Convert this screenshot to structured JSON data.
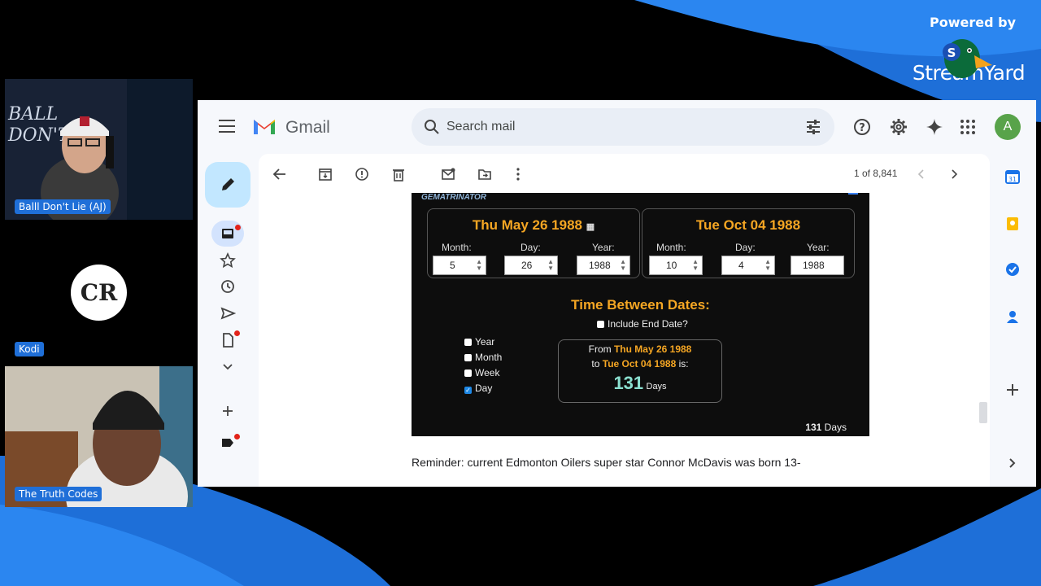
{
  "branding": {
    "powered_by": "Powered by",
    "name": "StreamYard"
  },
  "participants": [
    {
      "name": "Balll Don't Lie (AJ)"
    },
    {
      "name": "Kodi",
      "initials": "CR"
    },
    {
      "name": "The Truth Codes"
    }
  ],
  "gmail": {
    "app_name": "Gmail",
    "search_placeholder": "Search mail",
    "avatar_letter": "A",
    "pager": "1 of 8,841",
    "reminder": "Reminder: current Edmonton Oilers super star Connor McDavis was born 13-"
  },
  "calculator": {
    "brand": "GEMATRINATOR",
    "start_date": {
      "title": "Thu May 26 1988",
      "month": "5",
      "day": "26",
      "year": "1988"
    },
    "end_date": {
      "title": "Tue Oct 04 1988",
      "month": "10",
      "day": "4",
      "year": "1988"
    },
    "labels": {
      "month": "Month:",
      "day": "Day:",
      "year": "Year:"
    },
    "time_between": "Time Between Dates:",
    "include_end": "Include End Date?",
    "units": [
      "Year",
      "Month",
      "Week",
      "Day"
    ],
    "result": {
      "from": "From",
      "to": "to",
      "is": "is:",
      "value": "131",
      "unit": "Days"
    }
  }
}
